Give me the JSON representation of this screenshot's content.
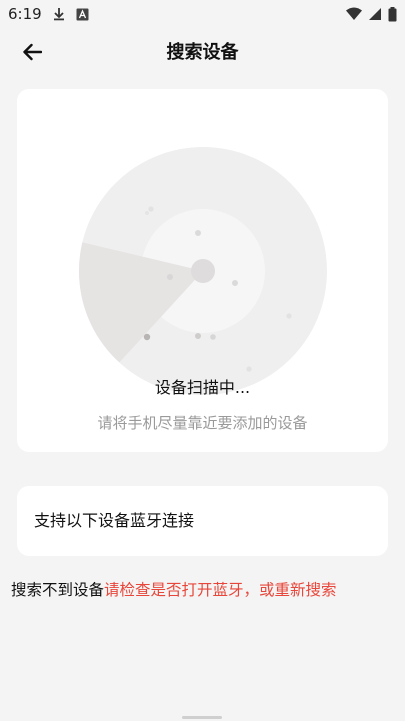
{
  "status_bar": {
    "time": "6:19",
    "icons": [
      "download-icon",
      "a-icon",
      "wifi-icon",
      "signal-icon",
      "battery-icon"
    ]
  },
  "header": {
    "title": "搜索设备"
  },
  "scan": {
    "status": "设备扫描中...",
    "hint": "请将手机尽量靠近要添加的设备"
  },
  "support": {
    "title": "支持以下设备蓝牙连接"
  },
  "help": {
    "prefix": "搜索不到设备",
    "alert": "请检查是否打开蓝牙，或重新搜索"
  },
  "colors": {
    "background": "#f4f4f4",
    "card": "#ffffff",
    "alert": "#e8463a",
    "muted": "#9a9a9a"
  }
}
